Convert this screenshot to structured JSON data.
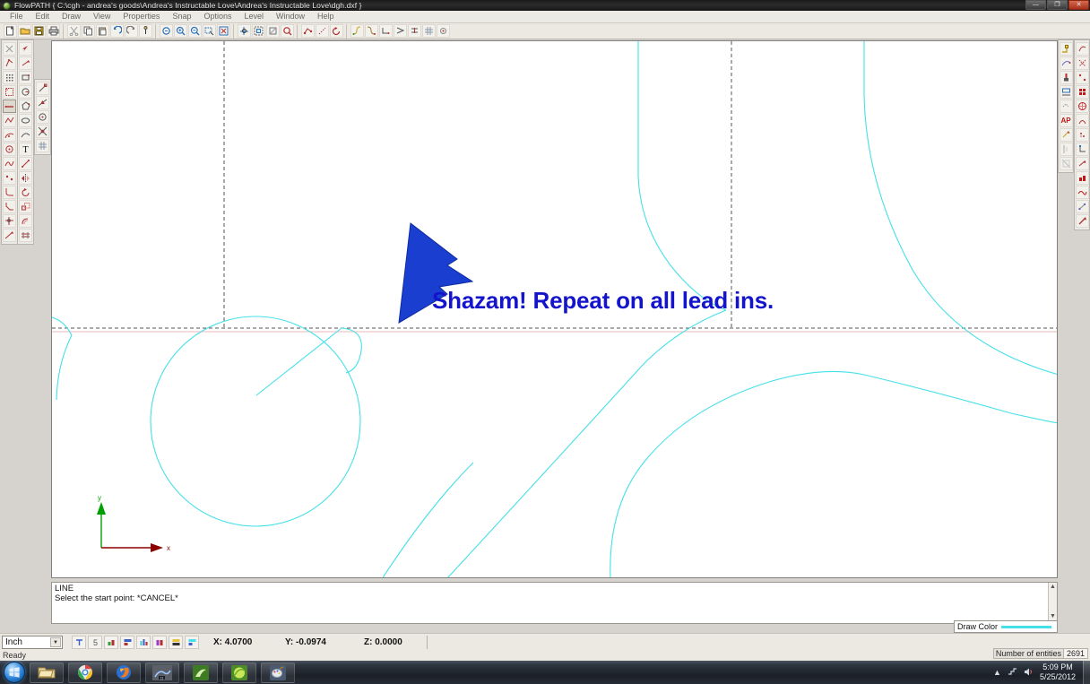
{
  "window": {
    "title": "FlowPATH { C:\\cgh - andrea's goods\\Andrea's Instructable Love\\Andrea's Instructable Love\\dgh.dxf }",
    "minimize_label": "—",
    "restore_label": "❐",
    "close_label": "✕"
  },
  "menu": {
    "items": [
      {
        "label": "File"
      },
      {
        "label": "Edit"
      },
      {
        "label": "Draw"
      },
      {
        "label": "View"
      },
      {
        "label": "Properties"
      },
      {
        "label": "Snap"
      },
      {
        "label": "Options"
      },
      {
        "label": "Level"
      },
      {
        "label": "Window"
      },
      {
        "label": "Help"
      }
    ]
  },
  "toolbar_top": {
    "groups": [
      {
        "name": "file",
        "buttons": [
          {
            "icon": "new-file-icon"
          },
          {
            "icon": "open-folder-icon"
          },
          {
            "icon": "save-disk-icon"
          },
          {
            "icon": "print-icon"
          }
        ]
      },
      {
        "name": "edit",
        "buttons": [
          {
            "icon": "cut-scissors-icon"
          },
          {
            "icon": "copy-icon"
          },
          {
            "icon": "paste-icon"
          },
          {
            "icon": "undo-icon"
          },
          {
            "icon": "redo-icon"
          },
          {
            "icon": "measure-icon"
          }
        ]
      },
      {
        "name": "zoom",
        "buttons": [
          {
            "icon": "zoom-previous-icon"
          },
          {
            "icon": "zoom-in-icon"
          },
          {
            "icon": "zoom-out-icon"
          },
          {
            "icon": "zoom-window-icon"
          },
          {
            "icon": "zoom-extents-icon"
          }
        ]
      },
      {
        "name": "view",
        "buttons": [
          {
            "icon": "pan-icon"
          },
          {
            "icon": "fit-view-icon"
          },
          {
            "icon": "redraw-icon"
          },
          {
            "icon": "regen-icon"
          }
        ]
      },
      {
        "name": "path",
        "buttons": [
          {
            "icon": "path-node-icon"
          },
          {
            "icon": "dotted-path-icon"
          },
          {
            "icon": "rotate-path-icon"
          }
        ]
      },
      {
        "name": "tools",
        "buttons": [
          {
            "icon": "lead-in-icon"
          },
          {
            "icon": "lead-out-icon"
          },
          {
            "icon": "corner-icon"
          },
          {
            "icon": "taper-icon"
          },
          {
            "icon": "kerf-icon"
          },
          {
            "icon": "grid-icon"
          },
          {
            "icon": "pierce-icon"
          }
        ]
      }
    ]
  },
  "toolbar_left": {
    "column1": [
      {
        "icon": "select-none-icon"
      },
      {
        "icon": "select-entity-icon"
      },
      {
        "icon": "select-grid-icon"
      },
      {
        "icon": "select-window-icon"
      },
      {
        "icon": "line-tool-icon"
      },
      {
        "icon": "polyline-tool-icon"
      },
      {
        "icon": "arc-tool-icon"
      },
      {
        "icon": "circle-tool-icon"
      },
      {
        "icon": "spline-tool-icon"
      },
      {
        "icon": "point-tool-icon"
      },
      {
        "icon": "fillet-tool-icon"
      },
      {
        "icon": "chamfer-tool-icon"
      },
      {
        "icon": "trim-tool-icon"
      },
      {
        "icon": "extend-tool-icon"
      }
    ],
    "column2": [
      {
        "icon": "arrow-select-icon"
      },
      {
        "icon": "move-tool-icon"
      },
      {
        "icon": "rectangle-tool-icon"
      },
      {
        "icon": "circle2-tool-icon"
      },
      {
        "icon": "polygon-tool-icon"
      },
      {
        "icon": "ellipse-tool-icon"
      },
      {
        "icon": "curve-tool-icon"
      },
      {
        "icon": "text-tool-icon"
      },
      {
        "icon": "dimension-line-icon"
      },
      {
        "icon": "mirror-tool-icon"
      },
      {
        "icon": "rotate-tool-icon"
      },
      {
        "icon": "scale-tool-icon"
      },
      {
        "icon": "offset-tool-icon"
      },
      {
        "icon": "array-tool-icon"
      }
    ],
    "column3": [
      {
        "icon": "snap-endpoint-icon"
      },
      {
        "icon": "snap-midpoint-icon"
      },
      {
        "icon": "snap-center-icon"
      },
      {
        "icon": "snap-intersect-icon"
      },
      {
        "icon": "snap-grid-icon"
      }
    ]
  },
  "toolbar_right": {
    "columnA": [
      {
        "icon": "leadin-add-icon"
      },
      {
        "icon": "leadout-add-icon"
      },
      {
        "icon": "pierce-point-icon"
      },
      {
        "icon": "order-path-icon"
      },
      {
        "icon": "link-path-icon"
      },
      {
        "icon": "auto-path-icon",
        "label": "AP"
      },
      {
        "icon": "reverse-path-icon"
      },
      {
        "icon": "verify-path-icon"
      },
      {
        "icon": "clear-path-icon"
      }
    ],
    "columnB": [
      {
        "icon": "head-origin-icon"
      },
      {
        "icon": "simulate-icon"
      },
      {
        "icon": "nest-icon"
      },
      {
        "icon": "table-icon"
      },
      {
        "icon": "tabs-icon"
      },
      {
        "icon": "bridge-icon"
      },
      {
        "icon": "corner-loop-icon"
      },
      {
        "icon": "small-corner-icon"
      },
      {
        "icon": "rapid-move-icon"
      },
      {
        "icon": "cut-speed-icon"
      },
      {
        "icon": "traverse-icon"
      },
      {
        "icon": "nodes-icon"
      },
      {
        "icon": "arrow-path-icon"
      }
    ]
  },
  "canvas": {
    "annotation": {
      "text": "Shazam! Repeat on all lead ins.",
      "color": "#1414cc",
      "arrow_color": "#1a3fd0"
    },
    "geometry_color": "#45e0e8",
    "construction_line_color": "#555555",
    "axis": {
      "y_label": "y",
      "x_label": "x",
      "y_color": "#00a000",
      "x_color": "#8b0000"
    }
  },
  "command": {
    "lines": [
      "LINE",
      "Select the start point: *CANCEL*"
    ],
    "scroll_up": "▲",
    "scroll_down": "▼"
  },
  "draw_color": {
    "label": "Draw Color",
    "swatch": "#45e0e8"
  },
  "status": {
    "unit": "Inch",
    "unit_arrow": "▼",
    "coord_x": "X: 4.0700",
    "coord_y": "Y: -0.0974",
    "coord_z": "Z: 0.0000",
    "ready": "Ready",
    "entities_label": "Number of entities",
    "entities_value": "2691",
    "level_buttons": [
      {
        "icon": "level-t-icon"
      },
      {
        "icon": "level-5-icon"
      },
      {
        "icon": "level-xh-icon"
      },
      {
        "icon": "level-fill-icon"
      },
      {
        "icon": "level-bars-icon"
      },
      {
        "icon": "level-blocks-icon"
      },
      {
        "icon": "level-yellow-icon"
      },
      {
        "icon": "level-cyan-icon"
      }
    ]
  },
  "taskbar": {
    "start": "start-orb-icon",
    "items": [
      {
        "icon": "windows-explorer-icon"
      },
      {
        "icon": "google-chrome-icon"
      },
      {
        "icon": "mozilla-firefox-icon"
      },
      {
        "icon": "flowpath-app-icon"
      },
      {
        "icon": "green-app-icon"
      },
      {
        "icon": "green-circle-app-icon"
      },
      {
        "icon": "paint-app-icon"
      }
    ],
    "tray": [
      {
        "icon": "show-hidden-icons-arrow"
      },
      {
        "icon": "network-icon"
      },
      {
        "icon": "volume-icon"
      }
    ],
    "time": "5:09 PM",
    "date": "5/25/2012"
  }
}
